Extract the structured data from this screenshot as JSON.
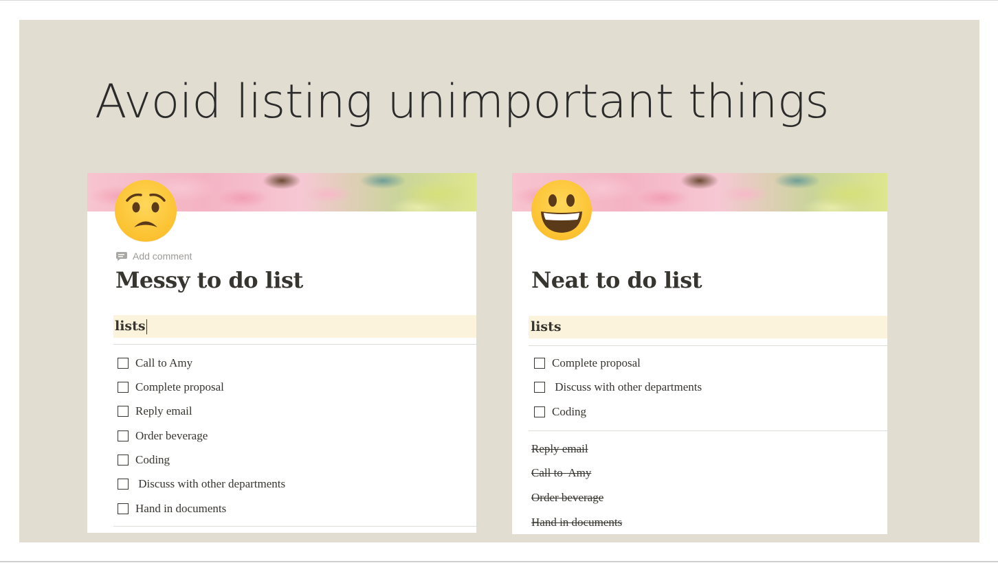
{
  "slide": {
    "title": "Avoid listing unimportant things"
  },
  "messy": {
    "emoji": "worried-face",
    "add_comment": "Add comment",
    "title": "Messy to do list",
    "section": "lists",
    "todos": [
      {
        "label": "Call to  Amy",
        "checked": false
      },
      {
        "label": "Complete proposal",
        "checked": false
      },
      {
        "label": "Reply email",
        "checked": false
      },
      {
        "label": "Order beverage",
        "checked": false
      },
      {
        "label": "Coding",
        "checked": false
      },
      {
        "label": " Discuss with other departments",
        "checked": false
      },
      {
        "label": "Hand in documents",
        "checked": false
      }
    ]
  },
  "neat": {
    "emoji": "grinning-face",
    "title": "Neat to do list",
    "section": "lists",
    "todos": [
      {
        "label": "Complete proposal",
        "checked": false
      },
      {
        "label": " Discuss with other departments",
        "checked": false
      },
      {
        "label": "Coding",
        "checked": false
      }
    ],
    "done": [
      "Reply email",
      "Call to  Amy",
      "Order beverage",
      "Hand in documents"
    ]
  },
  "colors": {
    "slide_background": "#e2ddd1",
    "heading_highlight": "#fbf3db",
    "text": "#37352f",
    "emoji_yellow": "#fbc02d"
  }
}
